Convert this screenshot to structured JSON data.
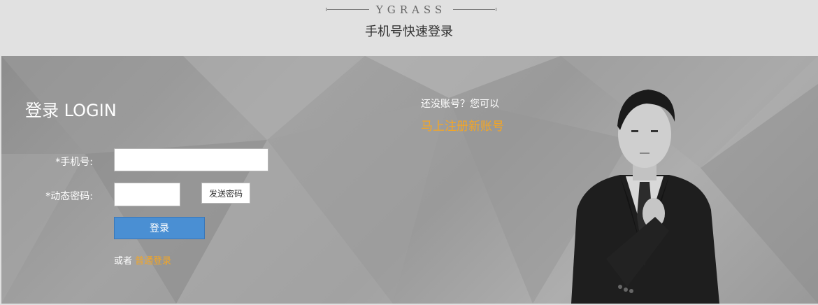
{
  "header": {
    "brand": "YGRASS",
    "subtitle": "手机号快速登录"
  },
  "login": {
    "title": "登录 LOGIN",
    "phone_label": "*手机号:",
    "code_label": "*动态密码:",
    "phone_value": "",
    "code_value": "",
    "send_code_label": "发送密码",
    "submit_label": "登录",
    "or_text": "或者",
    "normal_login_label": "普通登录"
  },
  "register": {
    "prompt": "还没账号？您可以",
    "link_label": "马上注册新账号"
  },
  "colors": {
    "accent_link": "#f5a623",
    "primary_button": "#4a8fd3"
  }
}
